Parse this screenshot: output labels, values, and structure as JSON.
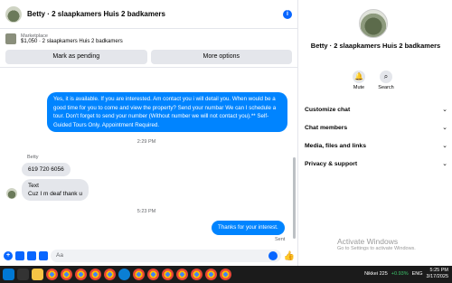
{
  "chat": {
    "title": "Betty · 2 slaapkamers Huis 2 badkamers",
    "info_icon": "info-icon",
    "marketplace": {
      "label": "Marketplace",
      "listing": "$1,050 · 2 slaapkamers Huis 2 badkamers",
      "pending_btn": "Mark as pending",
      "options_btn": "More options"
    },
    "messages": {
      "outgoing_1": "Yes, it is available. If you are interested.  Am contact you i will detail you.  When would be a good time for you to come and view the property? Send your numbar We can I schedule a tour.  Don't forget to send your number (Without number we will not contact you).** Self-Guided Tours Only. Appointment Required.",
      "time_1": "2:29 PM",
      "sender": "Betty",
      "incoming_1": "619 720 6056",
      "incoming_2": "Text\nCuz I m deaf thank u",
      "time_2": "5:23 PM",
      "outgoing_2": "Thanks for your interest.",
      "status": "Sent"
    },
    "composer": {
      "placeholder": "Aa"
    }
  },
  "sidebar": {
    "name": "Betty · 2 slaapkamers Huis 2 badkamers",
    "actions": [
      {
        "label": "Mute",
        "icon": "bell-icon"
      },
      {
        "label": "Search",
        "icon": "search-icon"
      }
    ],
    "sections": [
      "Customize chat",
      "Chat members",
      "Media, files and links",
      "Privacy & support"
    ]
  },
  "watermark": {
    "title": "Activate Windows",
    "subtitle": "Go to Settings to activate Windows."
  },
  "taskbar": {
    "ticker": "Nikkei 225",
    "change": "+0.93%",
    "lang": "ENG",
    "time": "5:25 PM",
    "date": "3/17/2025"
  },
  "colors": {
    "accent": "#0084ff",
    "brand": "#0866ff",
    "bubble_in": "#e4e6eb"
  }
}
